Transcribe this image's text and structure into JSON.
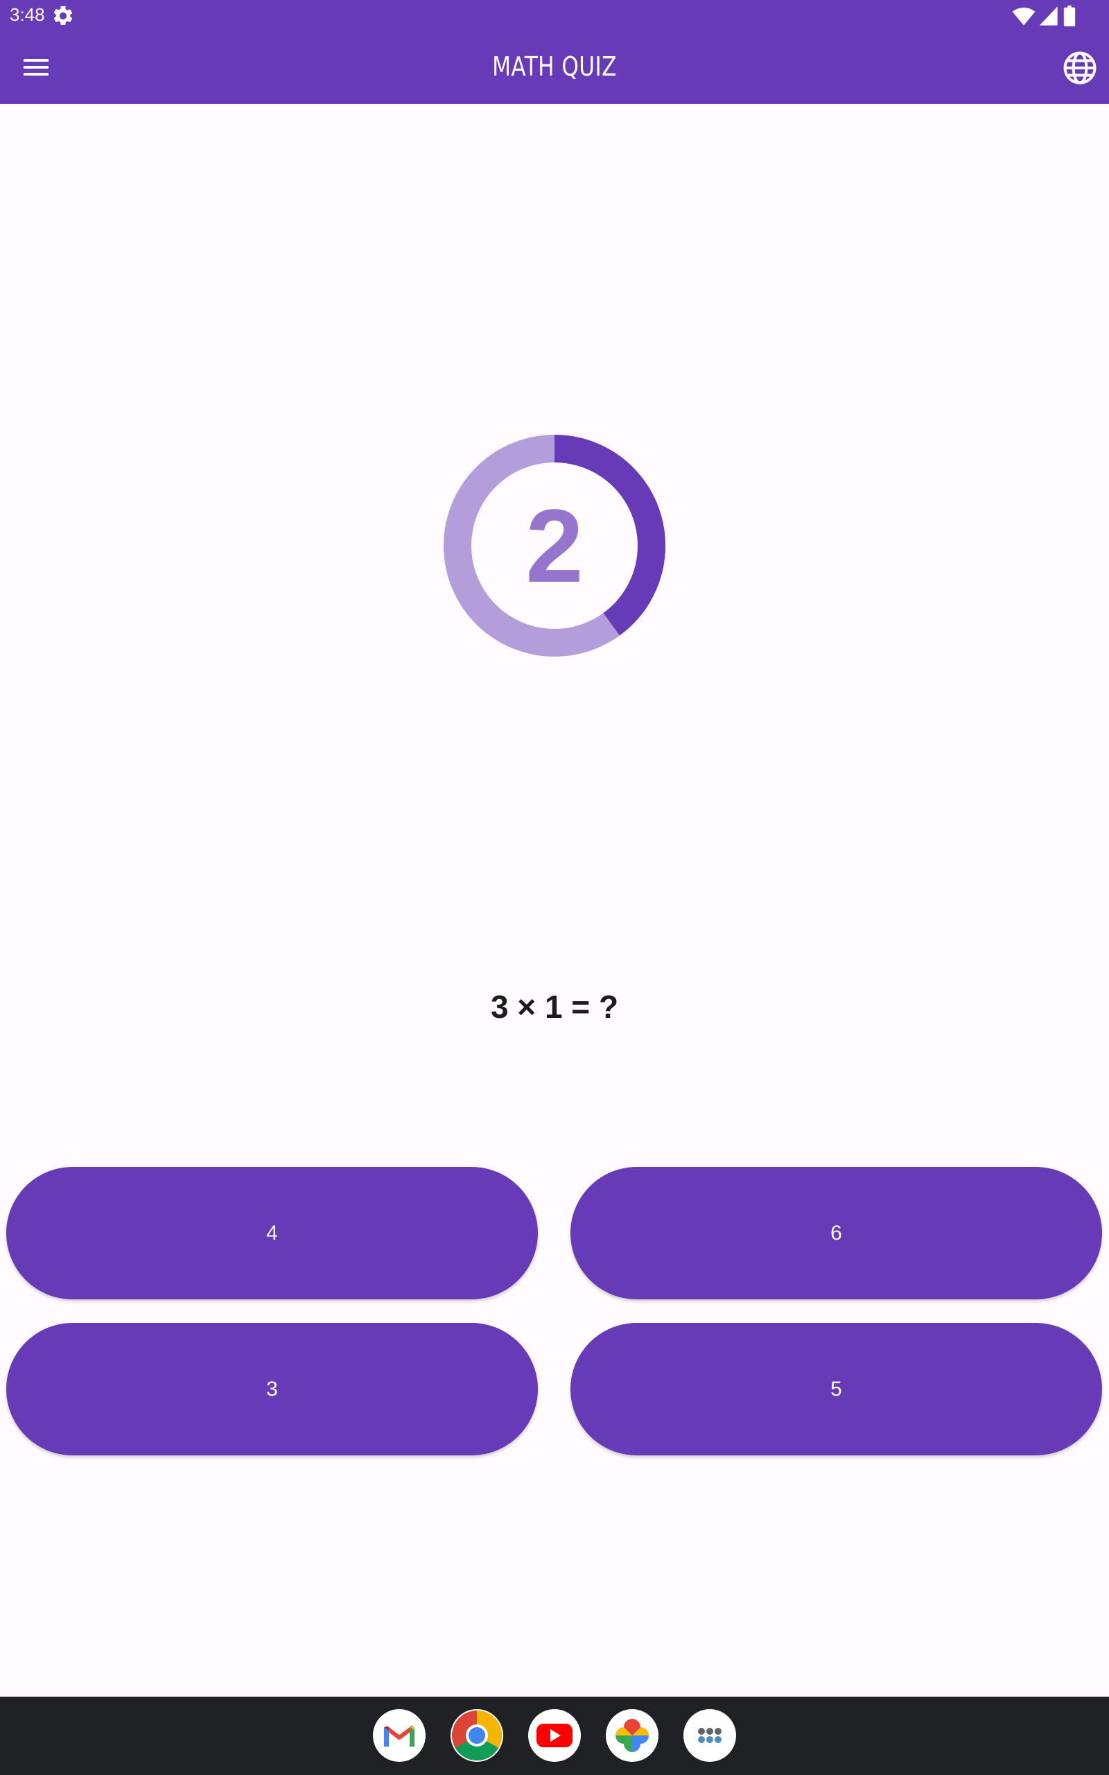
{
  "status_bar": {
    "time": "3:48",
    "icons": [
      "settings-gear-icon",
      "wifi-icon",
      "cell-signal-icon",
      "battery-icon"
    ]
  },
  "app_bar": {
    "title": "MATH QUIZ",
    "menu_icon": "menu-icon",
    "language_icon": "globe-icon"
  },
  "timer": {
    "seconds_left": "2",
    "progress_fraction": 0.4,
    "color_track": "#b39ddb",
    "color_progress": "#673ab7",
    "color_number": "#9575cd"
  },
  "question": {
    "text": "3 × 1 = ?"
  },
  "answers": [
    "4",
    "6",
    "3",
    "5"
  ],
  "colors": {
    "primary": "#673ab7",
    "background": "#fffbfe",
    "taskbar": "#202124"
  },
  "taskbar": {
    "apps": [
      "gmail-icon",
      "chrome-icon",
      "youtube-icon",
      "photos-icon",
      "app-drawer-icon"
    ]
  }
}
